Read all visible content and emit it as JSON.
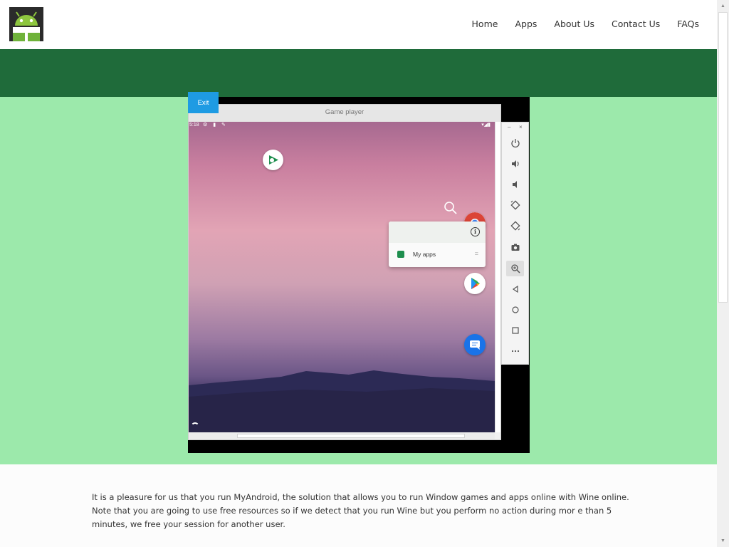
{
  "site": {
    "logo_icon": "android-robot-icon"
  },
  "nav": [
    {
      "label": "Home"
    },
    {
      "label": "Apps"
    },
    {
      "label": "About Us"
    },
    {
      "label": "Contact Us"
    },
    {
      "label": "FAQs"
    }
  ],
  "player": {
    "exit_label": "Exit",
    "window_title": "Game player",
    "status_time": "5:18",
    "popup_label": "My apps"
  },
  "toolbar": [
    "power-icon",
    "volume-up-icon",
    "volume-down-icon",
    "rotate-left-icon",
    "rotate-right-icon",
    "camera-icon",
    "zoom-icon",
    "back-icon",
    "home-icon",
    "overview-icon",
    "more-icon"
  ],
  "content": {
    "intro": "It is a pleasure for us that you run MyAndroid, the solution that allows you to run Window games and apps online with Wine online. Note that you are going to use free resources so if we detect that you run Wine but you perform no action during mor e than 5 minutes, we free your session for another user."
  },
  "colors": {
    "band": "#1f6b3a",
    "hero": "#9ce9ab",
    "exit": "#1e9be3",
    "logo_green": "#8ec63f"
  }
}
